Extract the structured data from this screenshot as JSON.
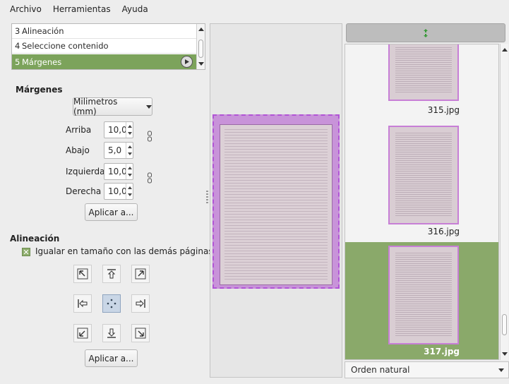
{
  "menubar": {
    "items": [
      "Archivo",
      "Herramientas",
      "Ayuda"
    ]
  },
  "stages": [
    {
      "num": "3",
      "label": "Alineación"
    },
    {
      "num": "4",
      "label": "Seleccione contenido"
    },
    {
      "num": "5",
      "label": "Márgenes"
    }
  ],
  "margins": {
    "title": "Márgenes",
    "units": "Milimetros (mm)",
    "top_label": "Arriba",
    "top_value": "10,0",
    "bottom_label": "Abajo",
    "bottom_value": "5,0",
    "left_label": "Izquierda",
    "left_value": "10,0",
    "right_label": "Derecha",
    "right_value": "10,0",
    "apply_label": "Aplicar a..."
  },
  "alignment": {
    "title": "Alineación",
    "match_size_label": "Igualar en tamaño con las demás páginas",
    "apply_label": "Aplicar a..."
  },
  "thumbnails": [
    {
      "label": "315.jpg"
    },
    {
      "label": "316.jpg"
    },
    {
      "label": "317.jpg",
      "selected": true
    }
  ],
  "sort": {
    "value": "Orden natural"
  },
  "colors": {
    "accent": "#7ca35b",
    "margin_overlay": "#c893d9"
  }
}
